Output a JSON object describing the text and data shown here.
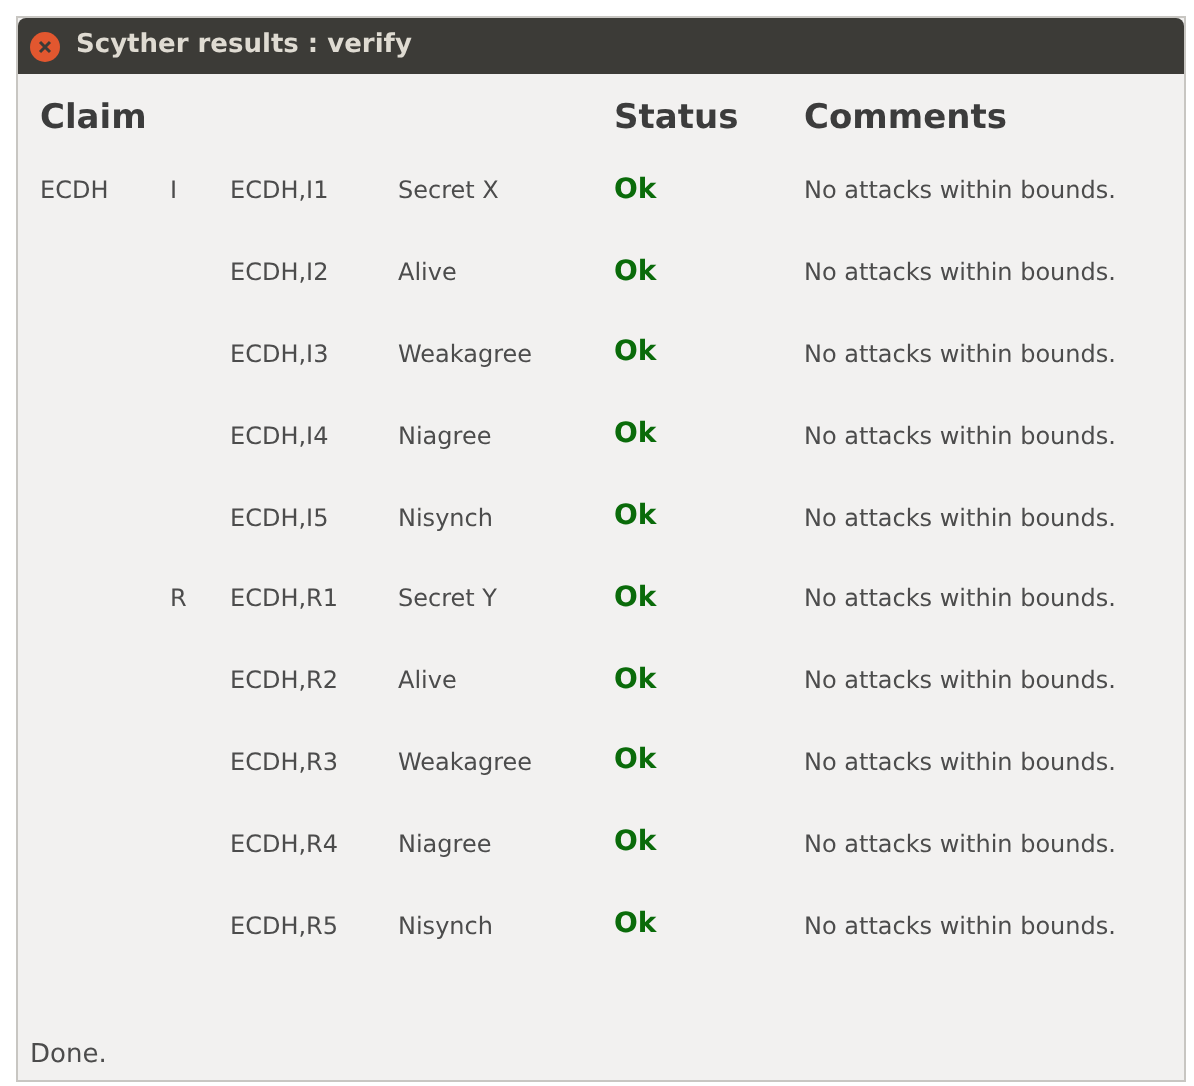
{
  "window": {
    "title": "Scyther results : verify"
  },
  "table": {
    "columns": [
      "Claim",
      "Status",
      "Comments"
    ],
    "rows": [
      {
        "protocol": "ECDH",
        "role": "I",
        "claim_id": "ECDH,I1",
        "claim": "Secret X",
        "status": "Ok",
        "comment": "No attacks within bounds."
      },
      {
        "claim_id": "ECDH,I2",
        "claim": "Alive",
        "status": "Ok",
        "comment": "No attacks within bounds."
      },
      {
        "claim_id": "ECDH,I3",
        "claim": "Weakagree",
        "status": "Ok",
        "comment": "No attacks within bounds."
      },
      {
        "claim_id": "ECDH,I4",
        "claim": "Niagree",
        "status": "Ok",
        "comment": "No attacks within bounds."
      },
      {
        "claim_id": "ECDH,I5",
        "claim": "Nisynch",
        "status": "Ok",
        "comment": "No attacks within bounds."
      },
      {
        "role": "R",
        "claim_id": "ECDH,R1",
        "claim": "Secret Y",
        "status": "Ok",
        "comment": "No attacks within bounds."
      },
      {
        "claim_id": "ECDH,R2",
        "claim": "Alive",
        "status": "Ok",
        "comment": "No attacks within bounds."
      },
      {
        "claim_id": "ECDH,R3",
        "claim": "Weakagree",
        "status": "Ok",
        "comment": "No attacks within bounds."
      },
      {
        "claim_id": "ECDH,R4",
        "claim": "Niagree",
        "status": "Ok",
        "comment": "No attacks within bounds."
      },
      {
        "claim_id": "ECDH,R5",
        "claim": "Nisynch",
        "status": "Ok",
        "comment": "No attacks within bounds."
      }
    ]
  },
  "status_bar": "Done."
}
